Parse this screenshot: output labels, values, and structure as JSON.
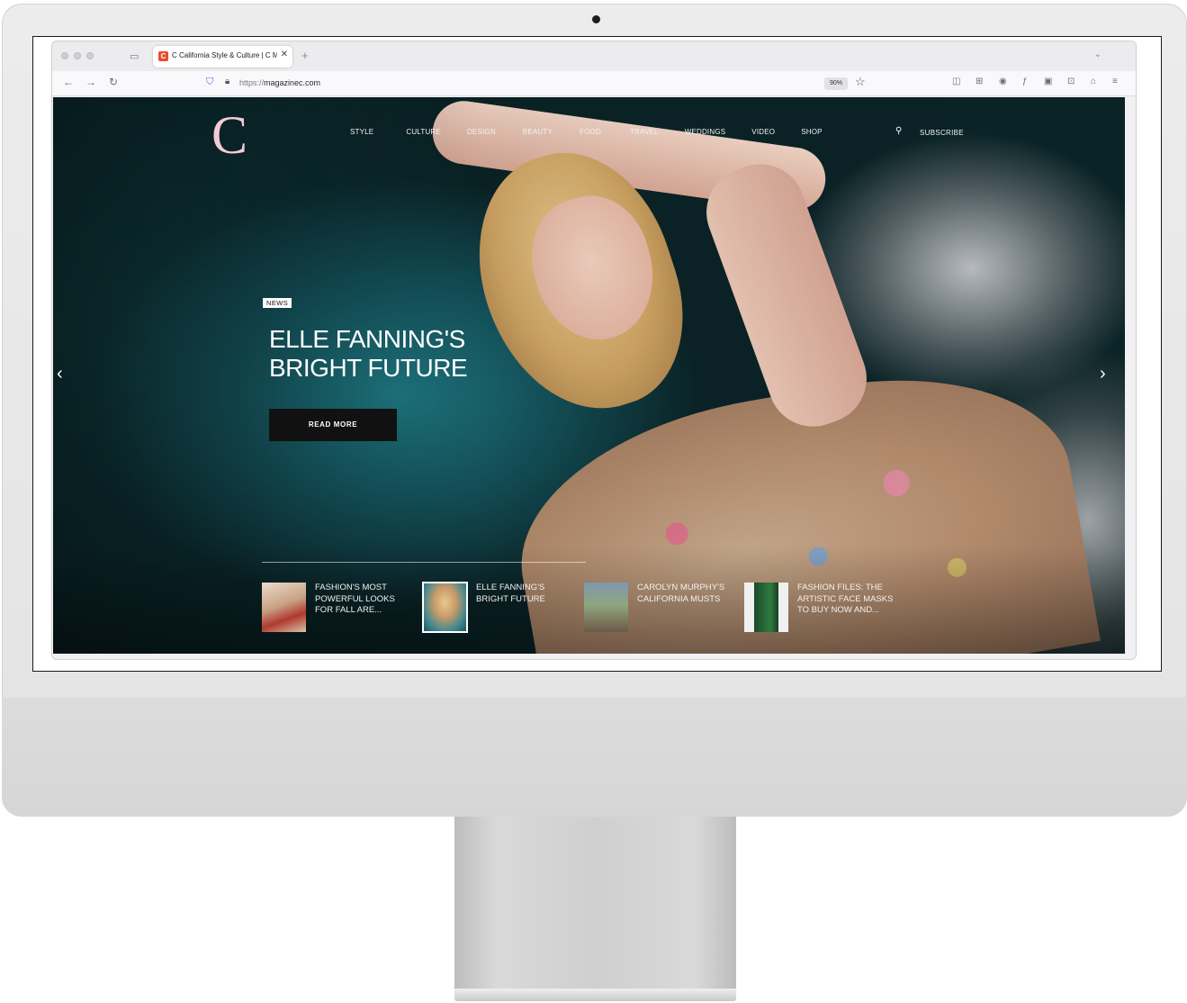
{
  "browser": {
    "tab": {
      "favicon": "C",
      "title": "C California Style & Culture | C M"
    },
    "tab_close": "✕",
    "new_tab": "+",
    "url_protocol": "https://",
    "url_host": "magazinec.com",
    "zoom": "90%"
  },
  "site": {
    "logo": "C",
    "menu": [
      "STYLE",
      "CULTURE",
      "DESIGN",
      "BEAUTY",
      "FOOD",
      "TRAVEL",
      "WEDDINGS",
      "VIDEO",
      "SHOP"
    ],
    "subscribe": "SUBSCRIBE",
    "hero": {
      "badge": "NEWS",
      "headline_line1": "ELLE FANNING'S",
      "headline_line2": "BRIGHT FUTURE",
      "cta": "READ MORE"
    },
    "teasers": [
      {
        "title": "FASHION'S MOST POWERFUL LOOKS FOR FALL ARE...",
        "active": false
      },
      {
        "title": "ELLE FANNING'S BRIGHT FUTURE",
        "active": true
      },
      {
        "title": "CAROLYN MURPHY'S CALIFORNIA MUSTS",
        "active": false
      },
      {
        "title": "FASHION FILES: THE ARTISTIC FACE MASKS TO BUY NOW AND...",
        "active": false
      }
    ]
  },
  "colors": {
    "logo": "#f3cbd6",
    "button": "#111111",
    "favicon": "#e84c2c"
  }
}
